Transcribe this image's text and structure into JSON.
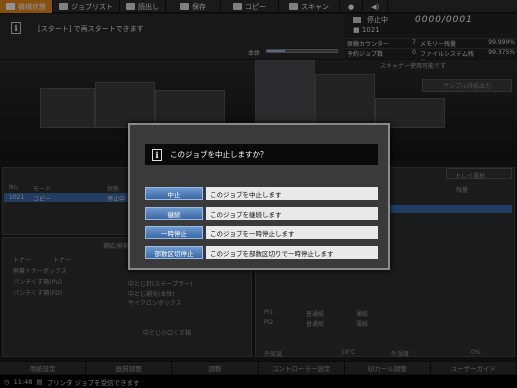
{
  "topbar": {
    "tabs": [
      {
        "label": "機械状態",
        "icon": "machine-status-icon",
        "active": true
      },
      {
        "label": "ジョブリスト",
        "icon": "job-list-icon",
        "active": false
      },
      {
        "label": "読出し",
        "icon": "retrieve-icon",
        "active": false
      },
      {
        "label": "保存",
        "icon": "save-icon",
        "active": false
      },
      {
        "label": "コピー",
        "icon": "copy-icon",
        "active": false
      },
      {
        "label": "スキャン",
        "icon": "scan-icon",
        "active": false
      }
    ],
    "globe_icon": "globe-icon",
    "volume_icon": "volume-icon"
  },
  "message": {
    "text": "[スタート] で再スタートできます",
    "icon": "info-icon",
    "memory_label": "本体",
    "memory_fraction": 0.25
  },
  "status_panel": {
    "state": "停止中",
    "counter": "0000/0001",
    "user": "1021",
    "rows": [
      {
        "l1": "原稿カウンター",
        "v1": "7",
        "l2": "メモリー残量",
        "v2": "99.999%"
      },
      {
        "l1": "予約ジョブ数",
        "v1": "0",
        "l2": "ファイルシステム残量",
        "v2": "99.375%"
      }
    ]
  },
  "scanner_status": "スキャナー使用可能です",
  "sample_button": "サンプル排紙出力",
  "background": {
    "job_header": [
      "No.",
      "モード",
      "状態"
    ],
    "job_row": [
      "1021",
      "コピー",
      "停止中"
    ],
    "print_select": "トレイ選択",
    "remaining_header": "残量",
    "supply_title": "補給/廃棄",
    "supplies": [
      "トナー",
      "トナー",
      "廃棄トナーボックス",
      "パンチくず箱(PU)",
      "パンチくず箱(FD)"
    ],
    "supplies_right": [
      "中とじ針(ステープラー)",
      "中とじ補充(本体)",
      "サイクロンボックス",
      "中とじ小口くず箱"
    ],
    "tray_rows": [
      {
        "name": "PI1",
        "paper": "普通紙",
        "type": "薄紙"
      },
      {
        "name": "PI2",
        "paper": "普通紙",
        "type": "薄紙"
      }
    ],
    "temp_label": "外気温",
    "temp_value": "18℃",
    "humidity_label": "外湿度",
    "humidity_value": "0%"
  },
  "bottombar": [
    "用紙設定",
    "画質調整",
    "調整",
    "コントローラー設定",
    "印カール調整",
    "ユーザーガイド"
  ],
  "statusline": {
    "time": "11:48",
    "text": "プリンタ ジョブを受信できます"
  },
  "dialog": {
    "title": "このジョブを中止しますか？",
    "options": [
      {
        "button": "中止",
        "desc": "このジョブを中止します"
      },
      {
        "button": "継続",
        "desc": "このジョブを継続します"
      },
      {
        "button": "一時停止",
        "desc": "このジョブを一時停止します"
      },
      {
        "button": "部数区切停止",
        "desc": "このジョブを部数区切りで一時停止します"
      }
    ]
  }
}
